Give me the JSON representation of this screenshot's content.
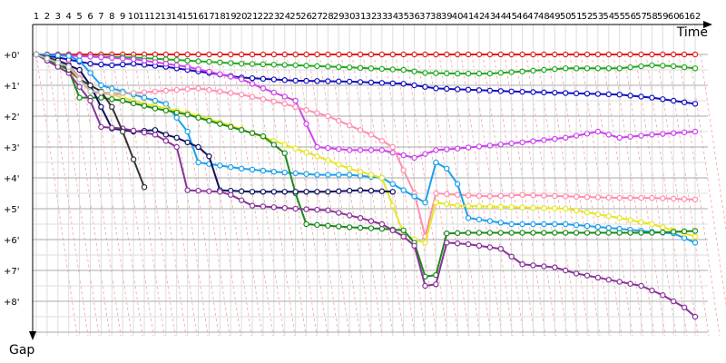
{
  "chart_data": {
    "type": "line",
    "xlabel": "Time",
    "ylabel": "Gap",
    "x": {
      "range": [
        1,
        62
      ],
      "tick_labels": [
        "1",
        "2",
        "3",
        "4",
        "5",
        "6",
        "7",
        "8",
        "9",
        "10",
        "11",
        "12",
        "13",
        "14",
        "15",
        "16",
        "17",
        "18",
        "19",
        "20",
        "21",
        "22",
        "23",
        "24",
        "25",
        "26",
        "27",
        "28",
        "29",
        "30",
        "31",
        "32",
        "33",
        "34",
        "35",
        "36",
        "37",
        "38",
        "39",
        "40",
        "41",
        "42",
        "43",
        "44",
        "45",
        "46",
        "47",
        "48",
        "49",
        "50",
        "51",
        "52",
        "53",
        "54",
        "55",
        "56",
        "57",
        "58",
        "59",
        "60",
        "61",
        "62"
      ]
    },
    "y": {
      "range": [
        0,
        9
      ],
      "inverted": true,
      "tick_labels": [
        "+0'",
        "+1'",
        "+2'",
        "+3'",
        "+4'",
        "+5'",
        "+6'",
        "+7'",
        "+8'"
      ]
    },
    "grid": true,
    "colors": {
      "grid": "#aaaaaa",
      "minor_grid": "#dddddd",
      "diagonal": "#f4a0a0"
    },
    "series": [
      {
        "color": "#e02020",
        "points": [
          [
            1,
            0
          ],
          [
            5,
            0
          ],
          [
            10,
            0
          ],
          [
            20,
            0
          ],
          [
            30,
            0
          ],
          [
            40,
            0
          ],
          [
            50,
            0
          ],
          [
            55,
            0
          ],
          [
            61,
            0
          ],
          [
            62,
            0
          ]
        ]
      },
      {
        "color": "#22aa22",
        "points": [
          [
            1,
            0
          ],
          [
            5,
            0.05
          ],
          [
            10,
            0.1
          ],
          [
            15,
            0.2
          ],
          [
            20,
            0.3
          ],
          [
            25,
            0.35
          ],
          [
            30,
            0.42
          ],
          [
            35,
            0.5
          ],
          [
            37,
            0.6
          ],
          [
            40,
            0.62
          ],
          [
            43,
            0.62
          ],
          [
            46,
            0.55
          ],
          [
            50,
            0.45
          ],
          [
            55,
            0.45
          ],
          [
            58,
            0.35
          ],
          [
            60,
            0.38
          ],
          [
            62,
            0.45
          ]
        ]
      },
      {
        "color": "#1010c0",
        "points": [
          [
            1,
            0
          ],
          [
            3,
            0.1
          ],
          [
            6,
            0.3
          ],
          [
            8,
            0.35
          ],
          [
            10,
            0.3
          ],
          [
            13,
            0.4
          ],
          [
            16,
            0.55
          ],
          [
            20,
            0.75
          ],
          [
            25,
            0.85
          ],
          [
            30,
            0.88
          ],
          [
            35,
            0.95
          ],
          [
            38,
            1.1
          ],
          [
            45,
            1.2
          ],
          [
            50,
            1.25
          ],
          [
            55,
            1.3
          ],
          [
            58,
            1.4
          ],
          [
            60,
            1.5
          ],
          [
            62,
            1.6
          ]
        ]
      },
      {
        "color": "#cc44ee",
        "points": [
          [
            1,
            0
          ],
          [
            5,
            0.05
          ],
          [
            10,
            0.15
          ],
          [
            15,
            0.4
          ],
          [
            20,
            0.8
          ],
          [
            22,
            1.1
          ],
          [
            25,
            1.5
          ],
          [
            27,
            3.0
          ],
          [
            30,
            3.1
          ],
          [
            33,
            3.1
          ],
          [
            36,
            3.35
          ],
          [
            38,
            3.1
          ],
          [
            40,
            3.05
          ],
          [
            43,
            2.95
          ],
          [
            46,
            2.85
          ],
          [
            50,
            2.7
          ],
          [
            53,
            2.5
          ],
          [
            55,
            2.7
          ],
          [
            58,
            2.6
          ],
          [
            62,
            2.5
          ]
        ]
      },
      {
        "color": "#ff8fb0",
        "points": [
          [
            1,
            0
          ],
          [
            4,
            0.3
          ],
          [
            6,
            1.2
          ],
          [
            8,
            1.3
          ],
          [
            12,
            1.2
          ],
          [
            16,
            1.1
          ],
          [
            20,
            1.3
          ],
          [
            24,
            1.6
          ],
          [
            28,
            2.0
          ],
          [
            32,
            2.6
          ],
          [
            34,
            3.0
          ],
          [
            36,
            4.5
          ],
          [
            37,
            5.9
          ],
          [
            38,
            4.5
          ],
          [
            40,
            4.55
          ],
          [
            43,
            4.6
          ],
          [
            46,
            4.55
          ],
          [
            50,
            4.6
          ],
          [
            55,
            4.65
          ],
          [
            58,
            4.65
          ],
          [
            62,
            4.7
          ]
        ]
      },
      {
        "color": "#1aa0ee",
        "points": [
          [
            1,
            0
          ],
          [
            4,
            0.05
          ],
          [
            5,
            0.2
          ],
          [
            7,
            1.0
          ],
          [
            10,
            1.3
          ],
          [
            13,
            1.6
          ],
          [
            15,
            2.5
          ],
          [
            16,
            3.5
          ],
          [
            18,
            3.6
          ],
          [
            20,
            3.7
          ],
          [
            23,
            3.8
          ],
          [
            27,
            3.9
          ],
          [
            30,
            3.9
          ],
          [
            33,
            4.0
          ],
          [
            35,
            4.4
          ],
          [
            37,
            4.8
          ],
          [
            38,
            3.5
          ],
          [
            39,
            3.7
          ],
          [
            40,
            4.2
          ],
          [
            41,
            5.3
          ],
          [
            45,
            5.5
          ],
          [
            50,
            5.5
          ],
          [
            55,
            5.65
          ],
          [
            58,
            5.75
          ],
          [
            60,
            5.8
          ],
          [
            62,
            6.1
          ]
        ]
      },
      {
        "color": "#e6e620",
        "points": [
          [
            1,
            0
          ],
          [
            3,
            0.4
          ],
          [
            5,
            0.8
          ],
          [
            7,
            1.2
          ],
          [
            11,
            1.6
          ],
          [
            15,
            1.9
          ],
          [
            19,
            2.3
          ],
          [
            23,
            2.8
          ],
          [
            27,
            3.3
          ],
          [
            30,
            3.7
          ],
          [
            33,
            4.0
          ],
          [
            35,
            5.8
          ],
          [
            36,
            6.0
          ],
          [
            37,
            6.1
          ],
          [
            38,
            4.8
          ],
          [
            40,
            4.9
          ],
          [
            45,
            4.95
          ],
          [
            50,
            5.0
          ],
          [
            55,
            5.3
          ],
          [
            58,
            5.5
          ],
          [
            60,
            5.7
          ],
          [
            62,
            5.9
          ]
        ]
      },
      {
        "color": "#1a8a1a",
        "points": [
          [
            1,
            0
          ],
          [
            4,
            0.5
          ],
          [
            5,
            1.4
          ],
          [
            7,
            1.4
          ],
          [
            9,
            1.5
          ],
          [
            12,
            1.75
          ],
          [
            15,
            1.95
          ],
          [
            19,
            2.35
          ],
          [
            22,
            2.65
          ],
          [
            24,
            3.2
          ],
          [
            25,
            4.5
          ],
          [
            26,
            5.5
          ],
          [
            28,
            5.55
          ],
          [
            30,
            5.6
          ],
          [
            33,
            5.65
          ],
          [
            35,
            5.7
          ],
          [
            36,
            6.1
          ],
          [
            37,
            7.2
          ],
          [
            38,
            7.15
          ],
          [
            39,
            5.8
          ],
          [
            41,
            5.78
          ],
          [
            45,
            5.78
          ],
          [
            50,
            5.78
          ],
          [
            55,
            5.78
          ],
          [
            58,
            5.78
          ],
          [
            62,
            5.72
          ]
        ]
      },
      {
        "color": "#101060",
        "points": [
          [
            1,
            0
          ],
          [
            3,
            0.2
          ],
          [
            5,
            0.5
          ],
          [
            6,
            1.0
          ],
          [
            8,
            2.4
          ],
          [
            10,
            2.5
          ],
          [
            12,
            2.45
          ],
          [
            13,
            2.6
          ],
          [
            14,
            2.7
          ],
          [
            16,
            3.0
          ],
          [
            17,
            3.3
          ],
          [
            18,
            4.4
          ],
          [
            21,
            4.45
          ],
          [
            24,
            4.45
          ],
          [
            28,
            4.45
          ],
          [
            31,
            4.4
          ],
          [
            34,
            4.45
          ]
        ]
      },
      {
        "color": "#883399",
        "points": [
          [
            1,
            0
          ],
          [
            4,
            0.6
          ],
          [
            6,
            1.5
          ],
          [
            7,
            2.35
          ],
          [
            9,
            2.4
          ],
          [
            12,
            2.6
          ],
          [
            14,
            3.0
          ],
          [
            15,
            4.4
          ],
          [
            18,
            4.45
          ],
          [
            19,
            4.55
          ],
          [
            21,
            4.9
          ],
          [
            25,
            5.0
          ],
          [
            28,
            5.05
          ],
          [
            31,
            5.3
          ],
          [
            33,
            5.5
          ],
          [
            35,
            5.9
          ],
          [
            36,
            6.2
          ],
          [
            37,
            7.5
          ],
          [
            38,
            7.45
          ],
          [
            39,
            6.1
          ],
          [
            41,
            6.15
          ],
          [
            44,
            6.3
          ],
          [
            46,
            6.8
          ],
          [
            49,
            6.9
          ],
          [
            51,
            7.1
          ],
          [
            54,
            7.3
          ],
          [
            57,
            7.5
          ],
          [
            59,
            7.8
          ],
          [
            61,
            8.2
          ],
          [
            62,
            8.5
          ]
        ]
      },
      {
        "color": "#333333",
        "points": [
          [
            1,
            0
          ],
          [
            3,
            0.2
          ],
          [
            5,
            0.8
          ],
          [
            7,
            1.2
          ],
          [
            8,
            1.7
          ],
          [
            9,
            2.5
          ],
          [
            10,
            3.4
          ],
          [
            11,
            4.3
          ]
        ]
      },
      {
        "color": "#bbbbbb",
        "points": [
          [
            1,
            0
          ],
          [
            4,
            0.4
          ],
          [
            6,
            1.2
          ],
          [
            8,
            1.25
          ],
          [
            10,
            1.25
          ]
        ]
      }
    ]
  }
}
